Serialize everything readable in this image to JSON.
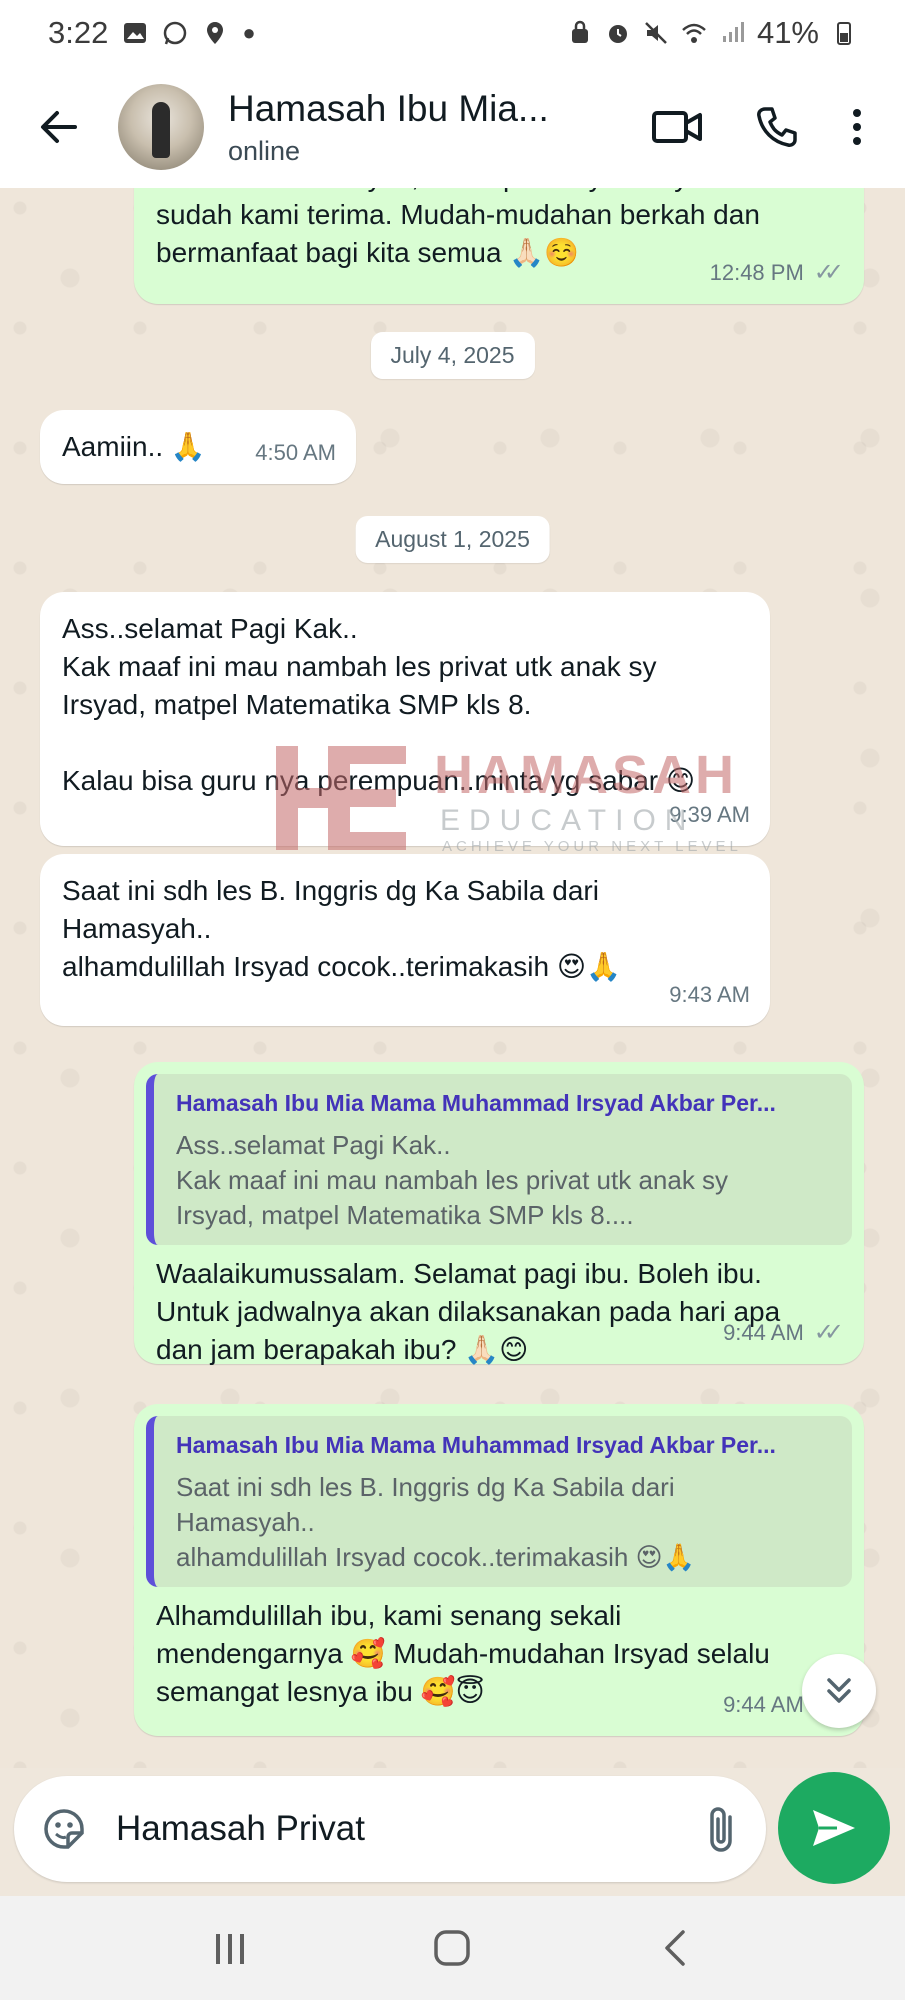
{
  "status_bar": {
    "time": "3:22",
    "battery": "41%"
  },
  "header": {
    "contact_name": "Hamasah Ibu Mia...",
    "status": "online"
  },
  "messages": [
    {
      "dir": "out",
      "text": "Terima kasih banyak, untuk pembayarannya\nsudah kami terima. Mudah-mudahan berkah dan\nbermanfaat bagi kita semua 🙏🏻☺️",
      "time": "12:48 PM"
    },
    {
      "dir": "date",
      "text": "July 4, 2025"
    },
    {
      "dir": "in",
      "text": "Aamiin.. 🙏",
      "time": "4:50 AM"
    },
    {
      "dir": "date",
      "text": "August 1, 2025"
    },
    {
      "dir": "in",
      "text": "Ass..selamat Pagi Kak..\nKak maaf ini mau nambah les privat utk anak sy\nIrsyad, matpel Matematika SMP kls 8.\n\nKalau bisa guru nya perempuan..minta yg sabar 😊",
      "time": "9:39 AM"
    },
    {
      "dir": "in",
      "text": "Saat ini sdh les B. Inggris dg Ka Sabila dari\nHamasyah..\nalhamdulillah Irsyad cocok..terimakasih 😍🙏",
      "time": "9:43 AM"
    },
    {
      "dir": "out",
      "quote_name": "Hamasah Ibu Mia Mama Muhammad Irsyad Akbar Per...",
      "quote_text": "Ass..selamat Pagi Kak..\nKak maaf ini mau nambah les privat utk anak sy\nIrsyad, matpel Matematika SMP kls 8....",
      "text": "Waalaikumussalam. Selamat pagi ibu. Boleh ibu.\nUntuk jadwalnya akan dilaksanakan pada hari apa\ndan jam berapakah ibu? 🙏🏻😊",
      "time": "9:44 AM"
    },
    {
      "dir": "out",
      "quote_name": "Hamasah Ibu Mia Mama Muhammad Irsyad Akbar Per...",
      "quote_text": "Saat ini sdh les B. Inggris dg Ka Sabila dari\nHamasyah..\nalhamdulillah Irsyad cocok..terimakasih 😍🙏",
      "text": "Alhamdulillah ibu, kami senang sekali\nmendengarnya 🥰 Mudah-mudahan Irsyad selalu\nsemangat lesnya ibu 🥰😇",
      "time": "9:44 AM"
    }
  ],
  "watermark": {
    "title": "HAMASAH",
    "subtitle": "EDUCATION",
    "tagline": "ACHIEVE YOUR NEXT LEVEL"
  },
  "composer": {
    "value": "Hamasah Privat"
  },
  "colors": {
    "outgoing": "#d9fdd3",
    "incoming": "#ffffff",
    "send": "#1daa61",
    "quote_bar": "#5e4fd9"
  },
  "icons": [
    "back-arrow-icon",
    "video-call-icon",
    "voice-call-icon",
    "more-vert-icon",
    "sticker-icon",
    "attach-icon",
    "send-icon",
    "scroll-down-icon"
  ]
}
